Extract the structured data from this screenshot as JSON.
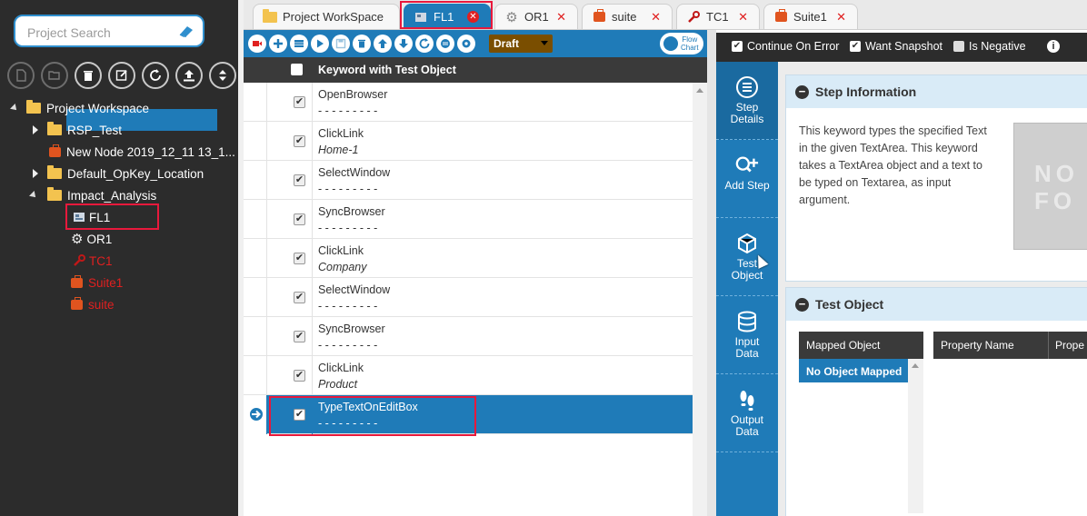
{
  "sidebar": {
    "search_placeholder": "Project Search",
    "tree": {
      "root": "Project Workspace",
      "rsp_test": "RSP_Test",
      "new_node": "New Node 2019_12_11 13_1...",
      "default_location": "Default_OpKey_Location",
      "impact_analysis": "Impact_Analysis",
      "fl1": "FL1",
      "or1": "OR1",
      "tc1": "TC1",
      "suite1": "Suite1",
      "suite": "suite"
    }
  },
  "tabs": [
    {
      "label": "Project WorkSpace"
    },
    {
      "label": "FL1"
    },
    {
      "label": "OR1"
    },
    {
      "label": "suite"
    },
    {
      "label": "TC1"
    },
    {
      "label": "Suite1"
    }
  ],
  "toolbar": {
    "status_value": "Draft",
    "flowchart_label_1": "Flow",
    "flowchart_label_2": "Chart"
  },
  "grid": {
    "header": "Keyword with Test Object",
    "steps": [
      {
        "keyword": "OpenBrowser",
        "object": "- - - - - - - - -"
      },
      {
        "keyword": "ClickLink",
        "object": "Home-1"
      },
      {
        "keyword": "SelectWindow",
        "object": "- - - - - - - - -"
      },
      {
        "keyword": "SyncBrowser",
        "object": "- - - - - - - - -"
      },
      {
        "keyword": "ClickLink",
        "object": "Company"
      },
      {
        "keyword": "SelectWindow",
        "object": "- - - - - - - - -"
      },
      {
        "keyword": "SyncBrowser",
        "object": "- - - - - - - - -"
      },
      {
        "keyword": "ClickLink",
        "object": "Product"
      },
      {
        "keyword": "TypeTextOnEditBox",
        "object": "- - - - - - - - -"
      }
    ]
  },
  "options": {
    "continue_on_error": "Continue On Error",
    "want_snapshot": "Want Snapshot",
    "is_negative": "Is Negative"
  },
  "vnav": {
    "step_details_1": "Step",
    "step_details_2": "Details",
    "add_step": "Add Step",
    "test_object_1": "Test",
    "test_object_2": "Object",
    "input_data_1": "Input",
    "input_data_2": "Data",
    "output_data_1": "Output",
    "output_data_2": "Data"
  },
  "step_info": {
    "title": "Step Information",
    "description": "This keyword types the specified Text in the given TextArea. This keyword takes a TextArea object and a text to be typed on Textarea, as input argument.",
    "no_image_text": "NO FO"
  },
  "test_object": {
    "title": "Test Object",
    "mapped_header": "Mapped Object",
    "mapped_value": "No Object Mapped",
    "property_name": "Property Name",
    "property_value": "Prope"
  },
  "colors": {
    "accent_blue": "#1f7bb8",
    "highlight_red": "#e8193c",
    "sidebar_bg": "#2c2c2c",
    "draft_brown": "#7a4e00"
  }
}
